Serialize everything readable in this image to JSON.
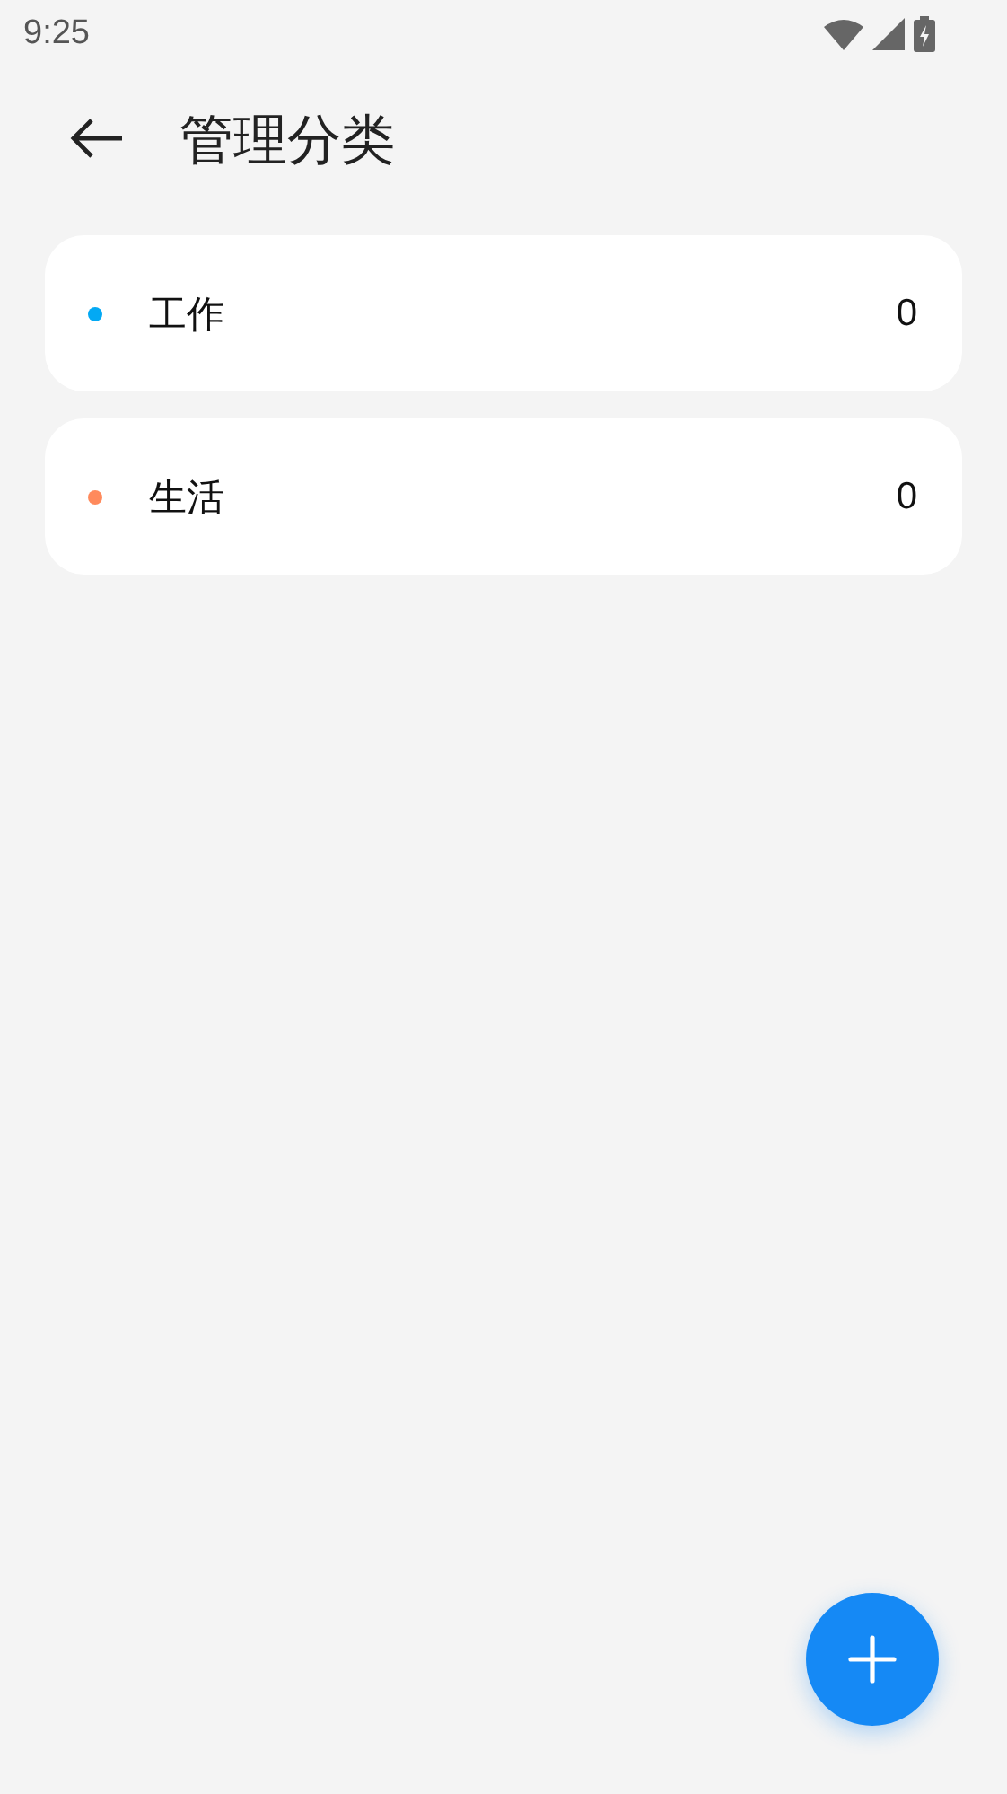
{
  "status_bar": {
    "time": "9:25"
  },
  "header": {
    "title": "管理分类"
  },
  "categories": [
    {
      "name": "工作",
      "count": "0",
      "color": "#03a9f4"
    },
    {
      "name": "生活",
      "count": "0",
      "color": "#ff8a5c"
    }
  ]
}
